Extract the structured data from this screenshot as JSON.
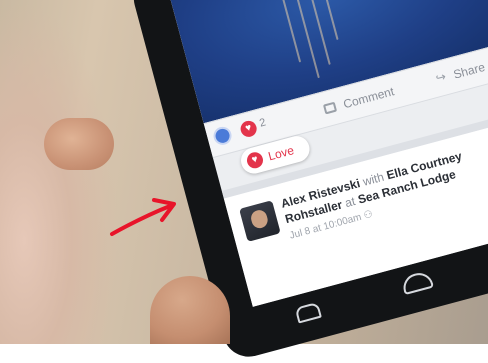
{
  "post": {
    "author": "Alex Ristevski",
    "with_text": "with",
    "tagged_person": "Ella Courtney Rohstaller",
    "at_text": "at",
    "place": "Sea Ranch Lodge",
    "meta": "Jul 8 at 10:00am",
    "privacy_icon": "people-icon"
  },
  "actions": {
    "love_count": "2",
    "comment_label": "Comment",
    "share_label": "Share"
  },
  "reaction_popup": {
    "love_label": "Love"
  },
  "colors": {
    "love_red": "#e3344b",
    "like_blue": "#4b7bd8",
    "annotation_red": "#e8142a"
  }
}
